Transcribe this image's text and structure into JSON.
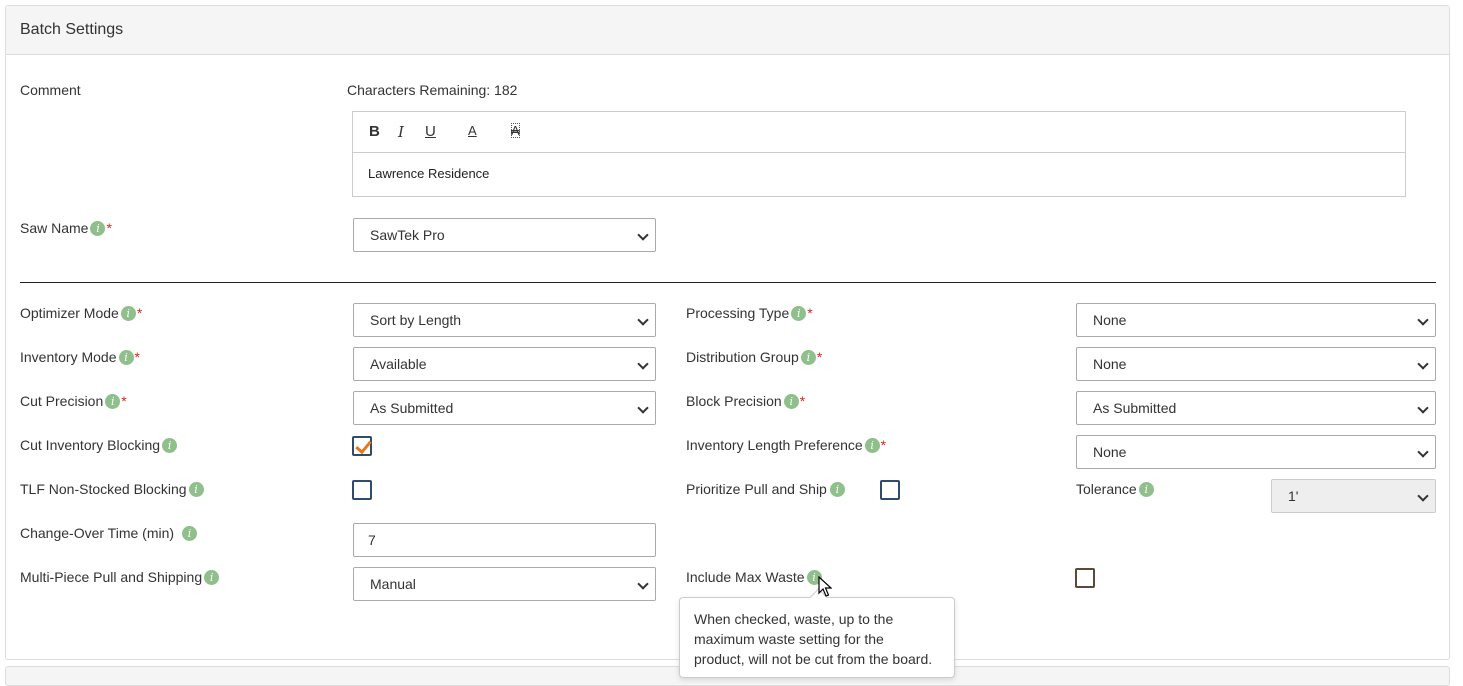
{
  "panel": {
    "title": "Batch Settings"
  },
  "comment": {
    "label": "Comment",
    "chars_remaining": "Characters Remaining: 182",
    "toolbar": {
      "bold": "B",
      "italic": "I",
      "underline": "U",
      "font_color": "A",
      "clear_format": "A"
    },
    "value": "Lawrence Residence"
  },
  "saw_name": {
    "label": "Saw Name",
    "value": "SawTek Pro"
  },
  "left": {
    "optimizer_mode": {
      "label": "Optimizer Mode",
      "value": "Sort by Length"
    },
    "inventory_mode": {
      "label": "Inventory Mode",
      "value": "Available"
    },
    "cut_precision": {
      "label": "Cut Precision",
      "value": "As Submitted"
    },
    "cut_inventory_blocking": {
      "label": "Cut Inventory Blocking",
      "checked": true
    },
    "tlf_non_stocked_blocking": {
      "label": "TLF Non-Stocked Blocking",
      "checked": false
    },
    "change_over_time": {
      "label": "Change-Over Time (min)",
      "value": "7"
    },
    "multi_piece": {
      "label": "Multi-Piece Pull and Shipping",
      "value": "Manual"
    }
  },
  "right": {
    "processing_type": {
      "label": "Processing Type",
      "value": "None"
    },
    "distribution_group": {
      "label": "Distribution Group",
      "value": "None"
    },
    "block_precision": {
      "label": "Block Precision",
      "value": "As Submitted"
    },
    "inventory_length_pref": {
      "label": "Inventory Length Preference",
      "value": "None"
    },
    "prioritize_pull": {
      "label": "Prioritize Pull and Ship",
      "checked": false
    },
    "tolerance": {
      "label": "Tolerance",
      "value": "1'"
    },
    "include_max_waste": {
      "label": "Include Max Waste",
      "checked": false
    }
  },
  "info_glyph": "i",
  "required_mark": "*",
  "tooltip": {
    "line1": "When checked, waste, up to the",
    "line2": "maximum waste setting for the",
    "line3": "product, will not be cut from the board."
  },
  "colors": {
    "info": "#8fbf8b",
    "required": "#d9261c",
    "check": "#e87722"
  }
}
